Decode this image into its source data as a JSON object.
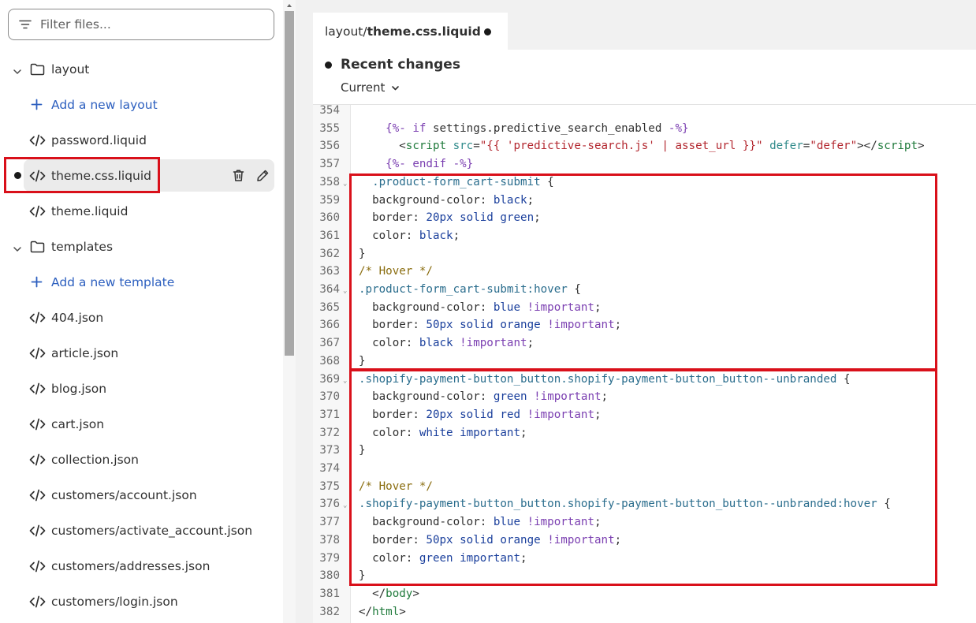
{
  "sidebar": {
    "filter_placeholder": "Filter files...",
    "items": [
      {
        "type": "folder",
        "label": "layout"
      },
      {
        "type": "add",
        "label": "Add a new layout"
      },
      {
        "type": "file",
        "label": "password.liquid"
      },
      {
        "type": "file",
        "label": "theme.css.liquid",
        "active": true
      },
      {
        "type": "file",
        "label": "theme.liquid"
      },
      {
        "type": "folder",
        "label": "templates"
      },
      {
        "type": "add",
        "label": "Add a new template"
      },
      {
        "type": "file",
        "label": "404.json"
      },
      {
        "type": "file",
        "label": "article.json"
      },
      {
        "type": "file",
        "label": "blog.json"
      },
      {
        "type": "file",
        "label": "cart.json"
      },
      {
        "type": "file",
        "label": "collection.json"
      },
      {
        "type": "file",
        "label": "customers/account.json"
      },
      {
        "type": "file",
        "label": "customers/activate_account.json"
      },
      {
        "type": "file",
        "label": "customers/addresses.json"
      },
      {
        "type": "file",
        "label": "customers/login.json"
      }
    ]
  },
  "editor": {
    "tab": {
      "folder": "layout/",
      "file": "theme.css.liquid"
    },
    "recent_changes": "Recent changes",
    "current_label": "Current"
  },
  "code_lines": [
    {
      "n": "354",
      "fold": false,
      "html": ""
    },
    {
      "n": "355",
      "fold": false,
      "html": "    <span class='c-kw'>{%- if</span> settings.predictive_search_enabled <span class='c-kw'>-%}</span>"
    },
    {
      "n": "356",
      "fold": false,
      "html": "      &lt;<span class='c-tag'>script</span> <span class='c-attr'>src</span>=<span class='c-str'>\"{{ 'predictive-search.js' | asset_url }}\"</span> <span class='c-attr'>defer</span>=<span class='c-str'>\"defer\"</span>&gt;&lt;/<span class='c-tag'>script</span>&gt;"
    },
    {
      "n": "357",
      "fold": false,
      "html": "    <span class='c-kw'>{%- endif -%}</span>"
    },
    {
      "n": "358",
      "fold": true,
      "html": "  <span class='c-sel'>.product-form_cart-submit</span> {"
    },
    {
      "n": "359",
      "fold": false,
      "html": "  background-color: <span class='c-val'>black</span>;"
    },
    {
      "n": "360",
      "fold": false,
      "html": "  border: <span class='c-val'>20px</span> <span class='c-val'>solid</span> <span class='c-val'>green</span>;"
    },
    {
      "n": "361",
      "fold": false,
      "html": "  color: <span class='c-val'>black</span>;"
    },
    {
      "n": "362",
      "fold": false,
      "html": "}"
    },
    {
      "n": "363",
      "fold": false,
      "html": "<span class='c-com'>/* Hover */</span>"
    },
    {
      "n": "364",
      "fold": true,
      "html": "<span class='c-sel'>.product-form_cart-submit:hover</span> {"
    },
    {
      "n": "365",
      "fold": false,
      "html": "  background-color: <span class='c-val'>blue</span> <span class='c-kw'>!important</span>;"
    },
    {
      "n": "366",
      "fold": false,
      "html": "  border: <span class='c-val'>50px</span> <span class='c-val'>solid</span> <span class='c-val'>orange</span> <span class='c-kw'>!important</span>;"
    },
    {
      "n": "367",
      "fold": false,
      "html": "  color: <span class='c-val'>black</span> <span class='c-kw'>!important</span>;"
    },
    {
      "n": "368",
      "fold": false,
      "html": "}"
    },
    {
      "n": "369",
      "fold": true,
      "html": "<span class='c-sel'>.shopify-payment-button_button.shopify-payment-button_button--unbranded</span> {"
    },
    {
      "n": "370",
      "fold": false,
      "html": "  background-color: <span class='c-val'>green</span> <span class='c-kw'>!important</span>;"
    },
    {
      "n": "371",
      "fold": false,
      "html": "  border: <span class='c-val'>20px</span> <span class='c-val'>solid</span> <span class='c-val'>red</span> <span class='c-kw'>!important</span>;"
    },
    {
      "n": "372",
      "fold": false,
      "html": "  color: <span class='c-val'>white</span> <span class='c-val'>important</span>;"
    },
    {
      "n": "373",
      "fold": false,
      "html": "}"
    },
    {
      "n": "374",
      "fold": false,
      "html": ""
    },
    {
      "n": "375",
      "fold": false,
      "html": "<span class='c-com'>/* Hover */</span>"
    },
    {
      "n": "376",
      "fold": true,
      "html": "<span class='c-sel'>.shopify-payment-button_button.shopify-payment-button_button--unbranded:hover</span> {"
    },
    {
      "n": "377",
      "fold": false,
      "html": "  background-color: <span class='c-val'>blue</span> <span class='c-kw'>!important</span>;"
    },
    {
      "n": "378",
      "fold": false,
      "html": "  border: <span class='c-val'>50px</span> <span class='c-val'>solid</span> <span class='c-val'>orange</span> <span class='c-kw'>!important</span>;"
    },
    {
      "n": "379",
      "fold": false,
      "html": "  color: <span class='c-val'>green</span> <span class='c-val'>important</span>;"
    },
    {
      "n": "380",
      "fold": false,
      "html": "}"
    },
    {
      "n": "381",
      "fold": false,
      "html": "  &lt;/<span class='c-tag'>body</span>&gt;"
    },
    {
      "n": "382",
      "fold": false,
      "html": "&lt;/<span class='c-tag'>html</span>&gt;"
    }
  ],
  "colors": {
    "highlight": "#d9101a",
    "link": "#2c5fbf",
    "active_row": "#ebebeb"
  }
}
